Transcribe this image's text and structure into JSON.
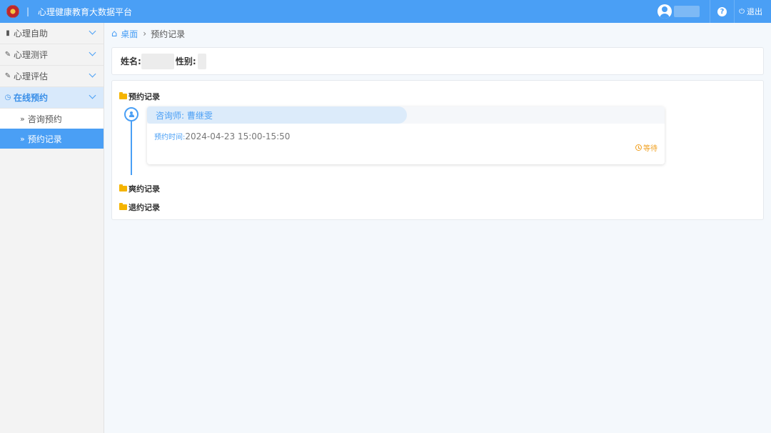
{
  "header": {
    "title": "心理健康教育大数据平台",
    "separator": "|",
    "help_label": "?",
    "logout_label": "退出"
  },
  "sidebar": {
    "items": [
      {
        "label": "心理自助",
        "icon": "book-icon"
      },
      {
        "label": "心理测评",
        "icon": "edit-icon"
      },
      {
        "label": "心理评估",
        "icon": "edit-icon"
      },
      {
        "label": "在线预约",
        "icon": "clock-icon",
        "active": true
      }
    ],
    "sub_items": [
      {
        "label": "咨询预约"
      },
      {
        "label": "预约记录",
        "selected": true
      }
    ]
  },
  "breadcrumb": {
    "home": "桌面",
    "separator": "›",
    "current": "预约记录"
  },
  "student_info": {
    "name_label": "姓名:",
    "sex_label": "性别:"
  },
  "records": {
    "appointment_section": "预约记录",
    "missed_section": "爽约记录",
    "cancelled_section": "退约记录",
    "appointments": [
      {
        "counselor": "咨询师:  曹继雯",
        "time_label": "预约时间:",
        "time": "2024-04-23 15:00-15:50",
        "status": "等待"
      }
    ]
  },
  "colors": {
    "primary": "#4a9ff5",
    "folder": "#f5b400",
    "status_waiting": "#f0a020"
  }
}
